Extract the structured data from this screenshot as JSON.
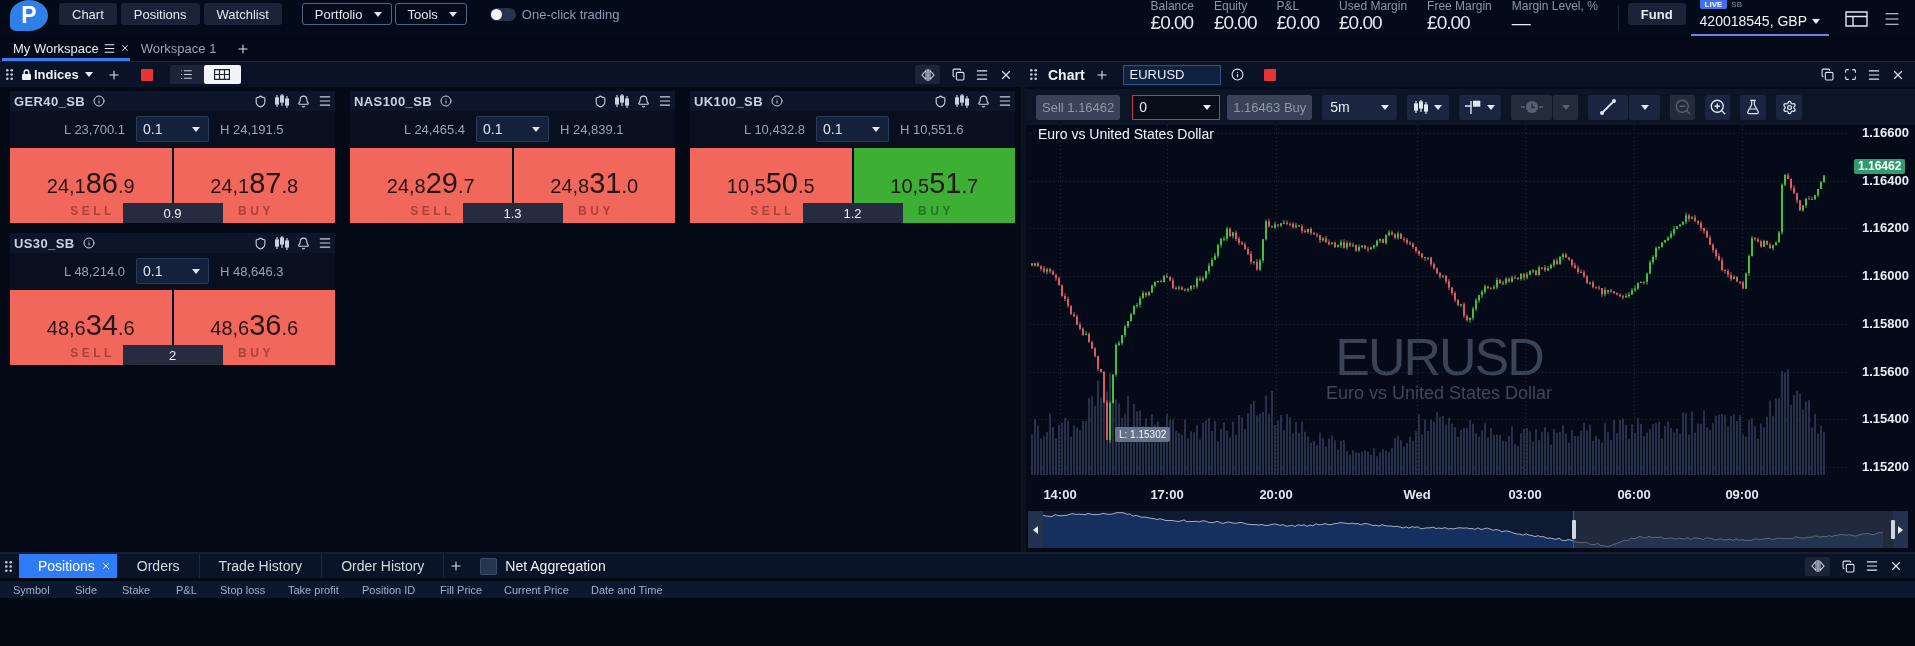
{
  "app_bar": {
    "logo": "P",
    "nav": [
      {
        "label": "Chart"
      },
      {
        "label": "Positions"
      },
      {
        "label": "Watchlist"
      }
    ],
    "menus": [
      {
        "label": "Portfolio"
      },
      {
        "label": "Tools"
      }
    ],
    "one_click_trading": {
      "label": "One-click trading",
      "on": false
    }
  },
  "account": {
    "stats": [
      {
        "label": "Balance",
        "value": "£0.00"
      },
      {
        "label": "Equity",
        "value": "£0.00"
      },
      {
        "label": "P&L",
        "value": "£0.00"
      },
      {
        "label": "Used Margin",
        "value": "£0.00"
      },
      {
        "label": "Free Margin",
        "value": "£0.00"
      },
      {
        "label": "Margin Level, %",
        "value": "—"
      }
    ],
    "fund_button": "Fund",
    "mode": "LIVE",
    "type": "SB",
    "account": "420018545, GBP"
  },
  "workspace_tabs": [
    {
      "label": "My Workspace",
      "selected": true
    },
    {
      "label": "Workspace 1",
      "selected": false
    }
  ],
  "watchlist": {
    "title": "Indices",
    "locked": true,
    "views": [
      {
        "kind": "list",
        "selected": false
      },
      {
        "kind": "grid",
        "selected": true
      }
    ],
    "tiles": [
      {
        "symbol": "GER40_SB",
        "low": "L 23,700.1",
        "quantity": "0.1",
        "high": "H 24,191.5",
        "sell": {
          "label": "SELL",
          "lead": "24,1",
          "pips": "86",
          "tail": ".9",
          "rising": false
        },
        "buy": {
          "label": "BUY",
          "lead": "24,1",
          "pips": "87",
          "tail": ".8",
          "rising": false
        },
        "spread": "0.9"
      },
      {
        "symbol": "NAS100_SB",
        "low": "L 24,465.4",
        "quantity": "0.1",
        "high": "H 24,839.1",
        "sell": {
          "label": "SELL",
          "lead": "24,8",
          "pips": "29",
          "tail": ".7",
          "rising": false
        },
        "buy": {
          "label": "BUY",
          "lead": "24,8",
          "pips": "31",
          "tail": ".0",
          "rising": false
        },
        "spread": "1.3"
      },
      {
        "symbol": "UK100_SB",
        "low": "L 10,432.8",
        "quantity": "0.1",
        "high": "H 10,551.6",
        "sell": {
          "label": "SELL",
          "lead": "10,5",
          "pips": "50",
          "tail": ".5",
          "rising": false
        },
        "buy": {
          "label": "BUY",
          "lead": "10,5",
          "pips": "51",
          "tail": ".7",
          "rising": true
        },
        "spread": "1.2"
      },
      {
        "symbol": "US30_SB",
        "low": "L 48,214.0",
        "quantity": "0.1",
        "high": "H 48,646.3",
        "sell": {
          "label": "SELL",
          "lead": "48,6",
          "pips": "34",
          "tail": ".6",
          "rising": false
        },
        "buy": {
          "label": "BUY",
          "lead": "48,6",
          "pips": "36",
          "tail": ".6",
          "rising": false
        },
        "spread": "2"
      }
    ]
  },
  "chart": {
    "title": "Chart",
    "symbol": "EURUSD",
    "toolbar": {
      "sell": "Sell 1.16462",
      "quantity": "0",
      "buy": "1.16463 Buy",
      "interval": "5m",
      "tools": [
        {
          "kind": "candles",
          "disabled": false
        },
        {
          "kind": "indicators",
          "disabled": false
        },
        {
          "kind": "clock",
          "disabled": true
        },
        {
          "kind": "line",
          "disabled": false
        },
        {
          "kind": "zoom_out",
          "disabled": true
        },
        {
          "kind": "zoom_in",
          "disabled": false
        },
        {
          "kind": "flask",
          "disabled": false
        },
        {
          "kind": "settings",
          "disabled": false
        }
      ]
    },
    "heading": "Euro vs United States Dollar",
    "watermark": {
      "symbol": "EURUSD",
      "name": "Euro vs United States Dollar"
    },
    "price_axis": [
      "1.16600",
      "1.16400",
      "1.16200",
      "1.16000",
      "1.15800",
      "1.15600",
      "1.15400",
      "1.15200"
    ],
    "last_price": "1.16462",
    "low_marker": "L: 1.15302",
    "time_axis": [
      "14:00",
      "17:00",
      "20:00",
      "Wed",
      "03:00",
      "06:00",
      "09:00"
    ]
  },
  "positions_panel": {
    "tabs": [
      {
        "label": "Positions",
        "selected": true
      },
      {
        "label": "Orders",
        "selected": false
      },
      {
        "label": "Trade History",
        "selected": false
      },
      {
        "label": "Order History",
        "selected": false
      }
    ],
    "net_aggregation": {
      "label": "Net Aggregation",
      "checked": false
    },
    "columns": [
      "Symbol",
      "Side",
      "Stake",
      "P&L",
      "Stop loss",
      "Take profit",
      "Position ID",
      "Fill Price",
      "Current Price",
      "Date and Time"
    ]
  }
}
